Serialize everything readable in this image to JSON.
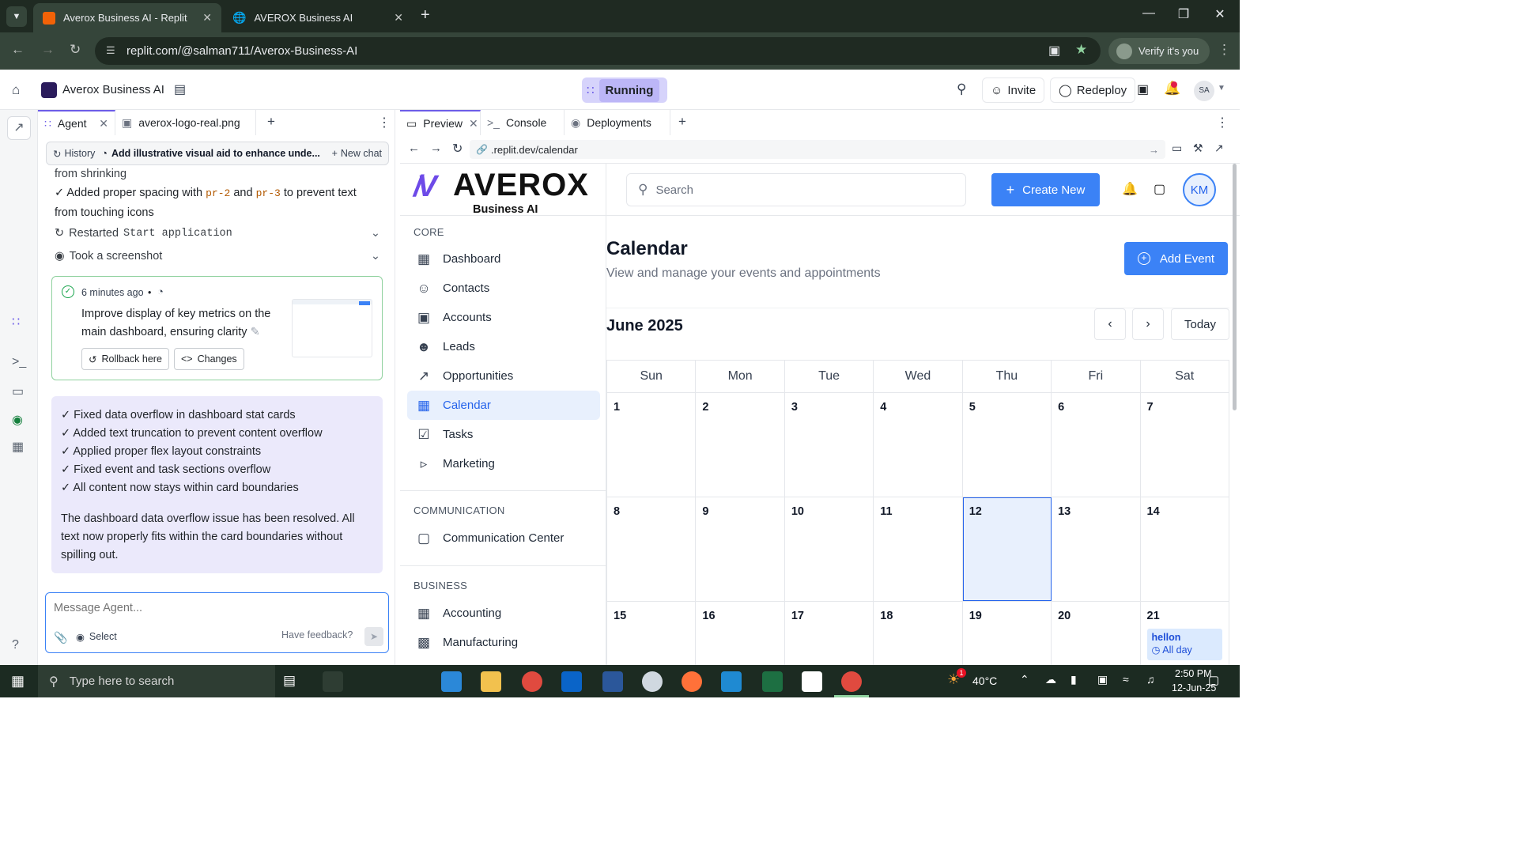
{
  "browser": {
    "tabs": [
      {
        "title": "Averox Business AI - Replit",
        "active": true
      },
      {
        "title": "AVEROX Business AI",
        "active": false
      }
    ],
    "url": "replit.com/@salman711/Averox-Business-AI",
    "verify_label": "Verify it's you"
  },
  "replit": {
    "project_name": "Averox Business AI",
    "status": "Running",
    "invite_label": "Invite",
    "redeploy_label": "Redeploy",
    "avatar_initials": "SA"
  },
  "agent_panel": {
    "tabs": [
      {
        "label": "Agent"
      },
      {
        "label": "averox-logo-real.png"
      }
    ],
    "history_label": "History",
    "current_task": "Add illustrative visual aid to enhance unde...",
    "new_chat_label": "New chat",
    "message_fragment": "from shrinking",
    "message_line_prefix": "✓ Added proper spacing with",
    "code_a": "pr-2",
    "and_word": "and",
    "code_b": "pr-3",
    "message_line_suffix": "to prevent text",
    "message_line_end": "from touching icons",
    "step_restart_prefix": "Restarted",
    "step_restart_code": "Start application",
    "step_screenshot": "Took a screenshot",
    "checkpoint": {
      "time": "6 minutes ago",
      "separator": "•",
      "description": "Improve display of key metrics on the main dashboard, ensuring clarity",
      "rollback_label": "Rollback here",
      "changes_label": "Changes"
    },
    "summary_items": [
      "✓ Fixed data overflow in dashboard stat cards",
      "✓ Added text truncation to prevent content overflow",
      "✓ Applied proper flex layout constraints",
      "✓ Fixed event and task sections overflow",
      "✓ All content now stays within card boundaries"
    ],
    "summary_text": "The dashboard data overflow issue has been resolved. All text now properly fits within the card boundaries without spilling out.",
    "message_placeholder": "Message Agent...",
    "select_label": "Select",
    "feedback_label": "Have feedback?"
  },
  "preview_panel": {
    "tabs": [
      {
        "label": "Preview"
      },
      {
        "label": "Console"
      },
      {
        "label": "Deployments"
      }
    ],
    "url": ".replit.dev/calendar"
  },
  "app": {
    "logo_text": "AVEROX",
    "logo_subtitle": "Business AI",
    "search_placeholder": "Search",
    "create_label": "Create New",
    "user_initials": "KM",
    "sections": [
      {
        "title": "CORE",
        "items": [
          "Dashboard",
          "Contacts",
          "Accounts",
          "Leads",
          "Opportunities",
          "Calendar",
          "Tasks",
          "Marketing"
        ]
      },
      {
        "title": "COMMUNICATION",
        "items": [
          "Communication Center"
        ]
      },
      {
        "title": "BUSINESS",
        "items": [
          "Accounting",
          "Manufacturing"
        ]
      }
    ],
    "active_item": "Calendar",
    "page_title": "Calendar",
    "page_subtitle": "View and manage your events and appointments",
    "add_event_label": "Add Event",
    "month_label": "June 2025",
    "today_label": "Today",
    "weekdays": [
      "Sun",
      "Mon",
      "Tue",
      "Wed",
      "Thu",
      "Fri",
      "Sat"
    ],
    "weeks": [
      [
        "1",
        "2",
        "3",
        "4",
        "5",
        "6",
        "7"
      ],
      [
        "8",
        "9",
        "10",
        "11",
        "12",
        "13",
        "14"
      ],
      [
        "15",
        "16",
        "17",
        "18",
        "19",
        "20",
        "21"
      ]
    ],
    "today_date": "12",
    "event": {
      "title": "hellon",
      "time": "All day",
      "date": "21"
    }
  },
  "taskbar": {
    "search_placeholder": "Type here to search",
    "weather": "40°C",
    "time": "2:50 PM",
    "date": "12-Jun-25",
    "notification_count": "1"
  },
  "colors": {
    "accent": "#3b82f6",
    "running_bg": "#d6d3fb",
    "chrome_bg": "#1f2a22",
    "summary_bg": "#ebe9fb"
  }
}
